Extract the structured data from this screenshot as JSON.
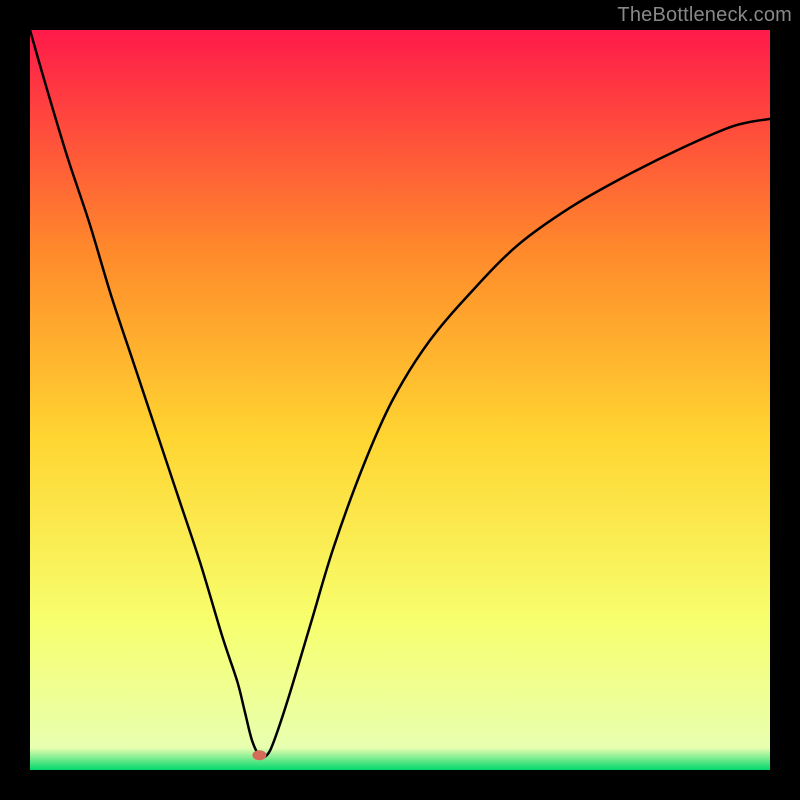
{
  "watermark": "TheBottleneck.com",
  "chart_data": {
    "type": "line",
    "title": "",
    "xlabel": "",
    "ylabel": "",
    "xlim": [
      0,
      100
    ],
    "ylim": [
      0,
      100
    ],
    "background_gradient": {
      "top": "#ff1a4a",
      "upper_mid": "#ff8a2b",
      "mid": "#ffd531",
      "lower_mid": "#f7ff6e",
      "bottom": "#00d86b"
    },
    "marker": {
      "x": 31,
      "y": 2,
      "color": "#d66b5a"
    },
    "x": [
      0,
      2,
      5,
      8,
      11,
      14,
      17,
      20,
      23,
      26,
      28,
      29,
      30,
      31,
      32,
      33,
      35,
      38,
      41,
      45,
      49,
      54,
      60,
      66,
      73,
      80,
      88,
      95,
      100
    ],
    "values": [
      100,
      93,
      83,
      74,
      64,
      55,
      46,
      37,
      28,
      18,
      12,
      8,
      4,
      2,
      2,
      4,
      10,
      20,
      30,
      41,
      50,
      58,
      65,
      71,
      76,
      80,
      84,
      87,
      88
    ]
  }
}
